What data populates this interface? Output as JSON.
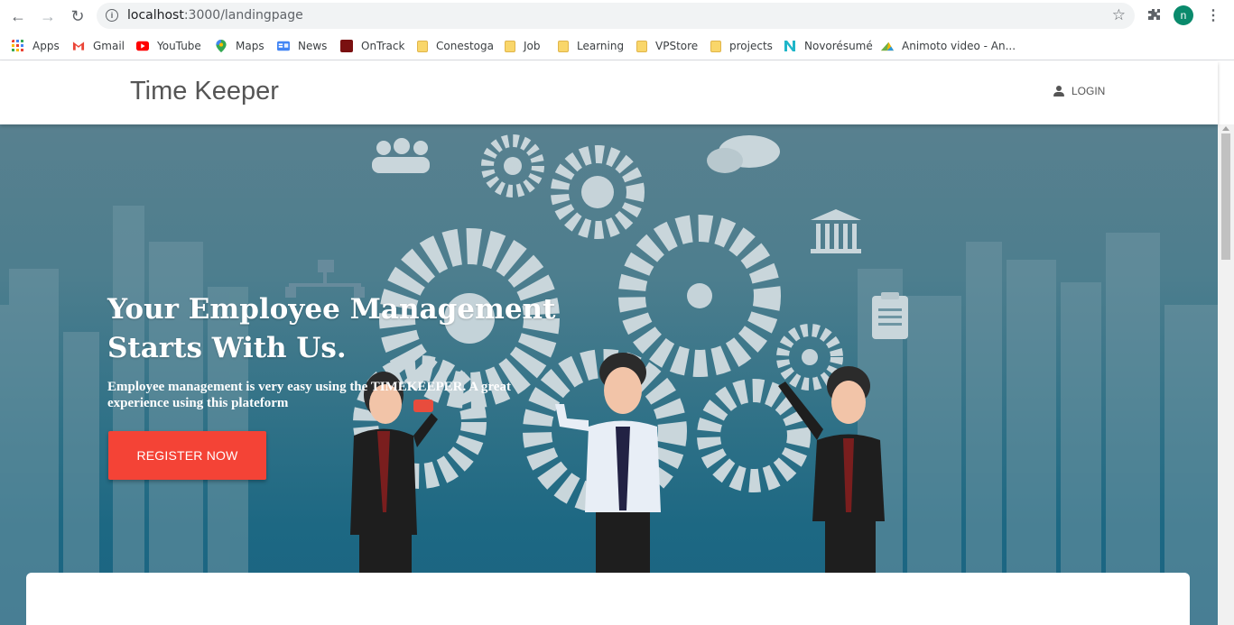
{
  "browser": {
    "url_host": "localhost",
    "url_path": ":3000/landingpage",
    "profile_initial": "n",
    "bookmarks": [
      {
        "label": "Apps",
        "icon": "apps-grid-icon",
        "color": "#4285f4"
      },
      {
        "label": "Gmail",
        "icon": "gmail-icon",
        "color": "#ea4335"
      },
      {
        "label": "YouTube",
        "icon": "youtube-icon",
        "color": "#ff0000"
      },
      {
        "label": "Maps",
        "icon": "maps-pin-icon",
        "color": "#34a853"
      },
      {
        "label": "News",
        "icon": "news-icon",
        "color": "#4285f4"
      },
      {
        "label": "OnTrack",
        "icon": "ontrack-icon",
        "color": "#8b0000"
      },
      {
        "label": "Conestoga",
        "icon": "folder-icon",
        "color": "#f9d66a"
      },
      {
        "label": "Job",
        "icon": "folder-icon",
        "color": "#f9d66a"
      },
      {
        "label": "Learning",
        "icon": "folder-icon",
        "color": "#f9d66a"
      },
      {
        "label": "VPStore",
        "icon": "folder-icon",
        "color": "#f9d66a"
      },
      {
        "label": "projects",
        "icon": "folder-icon",
        "color": "#f9d66a"
      },
      {
        "label": "Novorésumé",
        "icon": "novoresume-icon",
        "color": "#1fb6c9"
      },
      {
        "label": "Animoto video - An...",
        "icon": "animoto-icon",
        "color": "#f5b400"
      }
    ]
  },
  "header": {
    "brand": "Time Keeper",
    "login_label": "LOGIN"
  },
  "hero": {
    "title": "Your Employee Management Starts With Us.",
    "subtitle": "Employee management is very easy using the TIMEKEEPER. A great experience using this plateform",
    "register_label": "REGISTER NOW",
    "register_color": "#f44336"
  }
}
